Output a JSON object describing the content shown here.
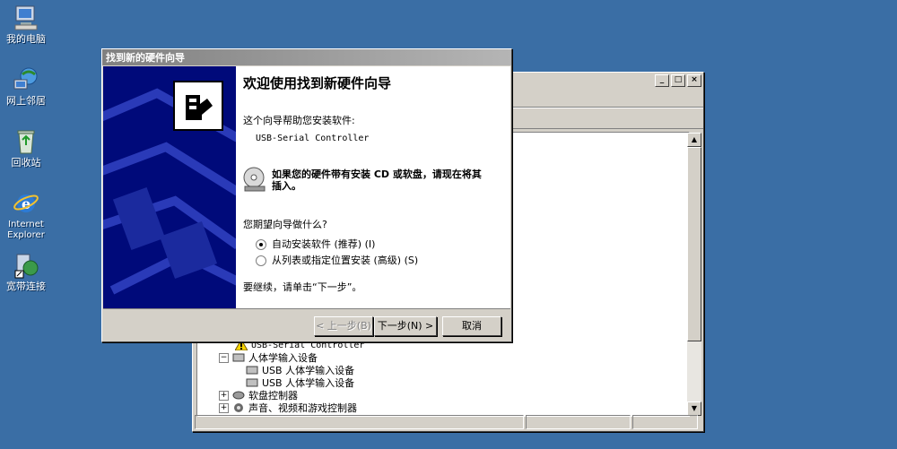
{
  "desktop": {
    "icons": [
      {
        "label": "我的电脑",
        "icon": "my-computer-icon"
      },
      {
        "label": "网上邻居",
        "icon": "network-icon"
      },
      {
        "label": "回收站",
        "icon": "recycle-bin-icon"
      },
      {
        "label": "Internet Explorer",
        "icon": "internet-explorer-icon"
      },
      {
        "label": "宽带连接",
        "icon": "broadband-connection-icon"
      }
    ]
  },
  "device_manager": {
    "tree_items": [
      {
        "label": "USB-Serial Controller",
        "level": 2,
        "warning": true
      },
      {
        "label": "人体学输入设备",
        "level": 1,
        "expanded": true
      },
      {
        "label": "USB 人体学输入设备",
        "level": 2
      },
      {
        "label": "USB 人体学输入设备",
        "level": 2
      },
      {
        "label": "软盘控制器",
        "level": 1,
        "expanded": false
      },
      {
        "label": "声音、视频和游戏控制器",
        "level": 1,
        "expanded": false
      }
    ]
  },
  "wizard": {
    "title": "找到新的硬件向导",
    "heading": "欢迎使用找到新硬件向导",
    "intro": "这个向导帮助您安装软件:",
    "device_name": "USB-Serial Controller",
    "cd_hint": "如果您的硬件带有安装 CD 或软盘，请现在将其插入。",
    "question": "您期望向导做什么?",
    "options": [
      {
        "label": "自动安装软件 (推荐) (I)",
        "selected": true
      },
      {
        "label": "从列表或指定位置安装 (高级) (S)",
        "selected": false
      }
    ],
    "continue_hint": "要继续，请单击“下一步”。",
    "buttons": {
      "back": "< 上一步(B)",
      "next": "下一步(N) >",
      "cancel": "取消"
    }
  },
  "colors": {
    "desktop": "#3a6ea5",
    "wizard_banner": "#000a7a",
    "inactive_title_start": "#808080"
  }
}
